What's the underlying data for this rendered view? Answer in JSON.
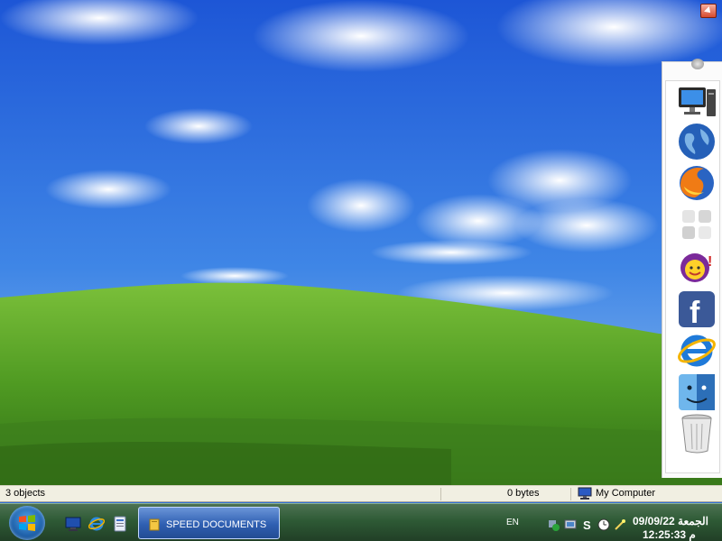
{
  "statusbar": {
    "objects": "3 objects",
    "size": "0 bytes",
    "location": "My Computer"
  },
  "taskbar": {
    "task_label": "SPEED DOCUMENTS",
    "language": "EN",
    "date": "الجمعة 09/09/22",
    "time": "م 12:25:33"
  },
  "dock": {
    "items": [
      "computer-icon",
      "globe-icon",
      "firefox-icon",
      "puzzle-icon",
      "yahoo-messenger-icon",
      "facebook-icon",
      "internet-explorer-icon",
      "finder-icon",
      "trash-icon"
    ]
  },
  "colors": {
    "sky": "#2f6fd9",
    "grass": "#5fa52a",
    "taskbar": "#2e5a35",
    "task_button": "#2f5fb2"
  }
}
